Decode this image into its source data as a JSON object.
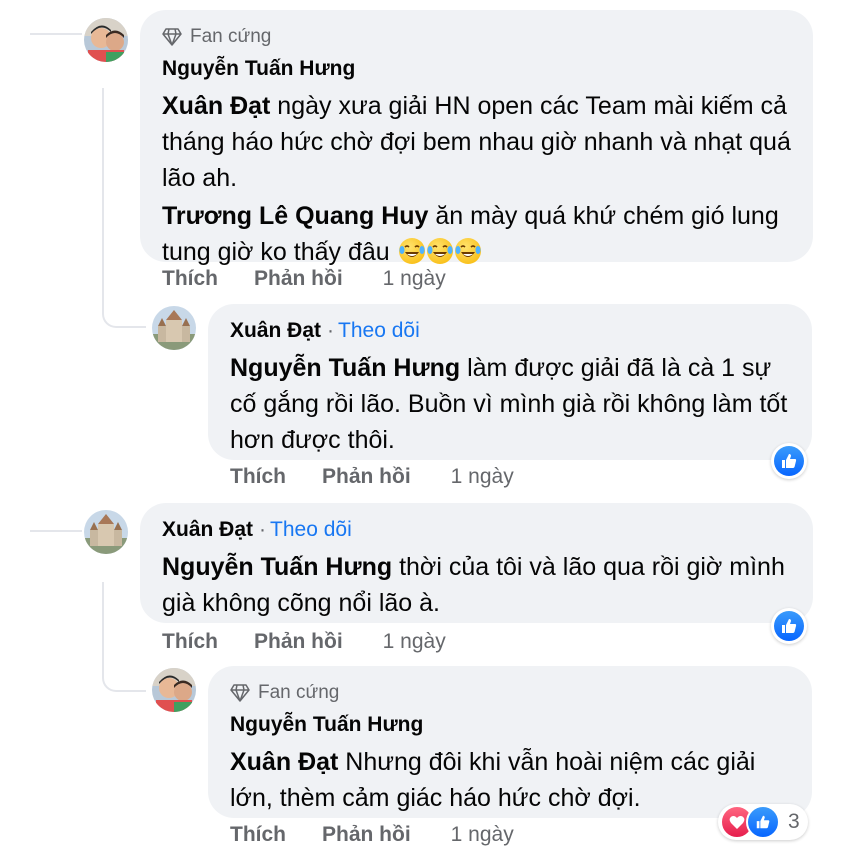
{
  "comments": [
    {
      "badge": "Fan cứng",
      "author": "Nguyễn Tuấn Hưng",
      "paragraphs": [
        {
          "mention": "Xuân Đạt",
          "text": " ngày xưa giải HN open các Team mài kiếm cả tháng háo hức chờ đợi bem nhau giờ nhanh và nhạt quá lão ah."
        },
        {
          "mention": "Trương Lê Quang Huy",
          "text": " ăn mày quá khứ chém gió lung tung giờ ko thấy đâu"
        }
      ],
      "emoji": [
        "face-with-tears-of-joy-icon",
        "face-with-tears-of-joy-icon",
        "face-with-tears-of-joy-icon"
      ],
      "actions": {
        "like": "Thích",
        "reply": "Phản hồi",
        "time": "1 ngày"
      }
    },
    {
      "author": "Xuân Đạt",
      "follow": "Theo dõi",
      "paragraphs": [
        {
          "mention": "Nguyễn Tuấn Hưng",
          "text": " làm được giải đã là cà 1 sự cố gắng rồi lão. Buồn vì mình già rồi không làm tốt hơn được thôi."
        }
      ],
      "reaction_icon": "like-icon",
      "actions": {
        "like": "Thích",
        "reply": "Phản hồi",
        "time": "1 ngày"
      }
    },
    {
      "author": "Xuân Đạt",
      "follow": "Theo dõi",
      "paragraphs": [
        {
          "mention": "Nguyễn Tuấn Hưng",
          "text": " thời của tôi và lão qua rồi giờ mình già không cõng nổi lão à."
        }
      ],
      "reaction_icon": "like-icon",
      "actions": {
        "like": "Thích",
        "reply": "Phản hồi",
        "time": "1 ngày"
      }
    },
    {
      "badge": "Fan cứng",
      "author": "Nguyễn Tuấn Hưng",
      "paragraphs": [
        {
          "mention": "Xuân Đạt",
          "text": " Nhưng đôi khi vẫn hoài niệm các giải lớn, thèm cảm giác háo hức chờ đợi."
        }
      ],
      "reactions": {
        "icons": [
          "heart-icon",
          "like-icon"
        ],
        "count": "3"
      },
      "actions": {
        "like": "Thích",
        "reply": "Phản hồi",
        "time": "1 ngày"
      }
    }
  ],
  "colors": {
    "bubble": "#f0f2f5",
    "follow": "#1877f2",
    "secondary_text": "#65676b",
    "like_blue": "#0866ff",
    "heart_red": "#e61e4d"
  }
}
